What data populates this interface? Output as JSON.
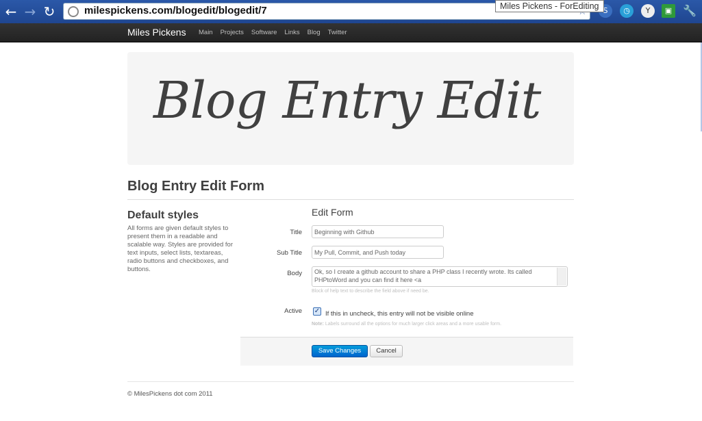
{
  "browser": {
    "url": "milespickens.com/blogedit/blogedit/7",
    "tooltip": "Miles Pickens - ForEditing"
  },
  "topbar": {
    "brand": "Miles Pickens",
    "nav": [
      "Main",
      "Projects",
      "Software",
      "Links",
      "Blog",
      "Twitter"
    ]
  },
  "hero": {
    "heading": "Blog Entry Edit"
  },
  "page": {
    "title": "Blog Entry Edit Form"
  },
  "sidebar": {
    "heading": "Default styles",
    "text": "All forms are given default styles to present them in a readable and scalable way. Styles are provided for text inputs, select lists, textareas, radio buttons and checkboxes, and buttons."
  },
  "form": {
    "legend": "Edit Form",
    "title_label": "Title",
    "title_value": "Beginning with Github",
    "subtitle_label": "Sub Title",
    "subtitle_value": "My Pull, Commit, and Push today",
    "body_label": "Body",
    "body_value": "Ok, so I create a github account to share a PHP class I recently wrote.  Its called PHPtoWord and you can find it here <a",
    "body_help": "Block of help text to describe the field above if need be.",
    "active_label": "Active",
    "active_checked": true,
    "active_text": "If this in uncheck, this entry will not be visible online",
    "note_label": "Note:",
    "note_text": "Labels surround all the options for much larger click areas and a more usable form.",
    "save_label": "Save Changes",
    "cancel_label": "Cancel"
  },
  "footer": {
    "text": "© MilesPickens dot com 2011"
  }
}
